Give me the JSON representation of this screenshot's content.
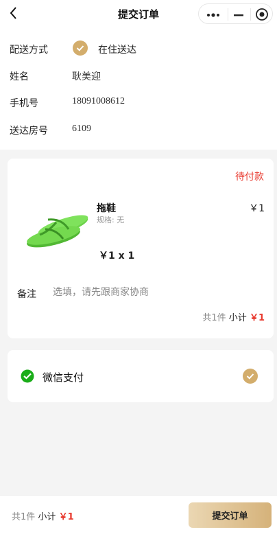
{
  "header": {
    "title": "提交订单",
    "back_icon": "chevron-left-icon",
    "capsule_more_icon": "more-dots-icon",
    "capsule_min_icon": "minimize-icon",
    "capsule_close_icon": "target-icon"
  },
  "form": {
    "delivery": {
      "label": "配送方式",
      "option": "在住送达",
      "selected": true
    },
    "name": {
      "label": "姓名",
      "value": "耿美迎"
    },
    "phone": {
      "label": "手机号",
      "value": "18091008612"
    },
    "room": {
      "label": "送达房号",
      "value": "6109"
    }
  },
  "order": {
    "status": "待付款",
    "product": {
      "name": "拖鞋",
      "spec": "规格: 无",
      "price": "￥1",
      "qty": "￥1 x 1"
    },
    "note": {
      "label": "备注",
      "placeholder": "选填，请先跟商家协商",
      "value": ""
    },
    "subtotal": {
      "count": "共1件",
      "label": "小计",
      "amount": "￥1"
    }
  },
  "payment": {
    "method": "微信支付",
    "selected": true,
    "icon": "wechat-pay-icon"
  },
  "bottom": {
    "count": "共1件",
    "label": "小计",
    "amount": "￥1",
    "submit_label": "提交订单"
  },
  "colors": {
    "accent_gold": "#d3ad6c",
    "price_red": "#e8392e",
    "wechat_green": "#1aad19"
  }
}
